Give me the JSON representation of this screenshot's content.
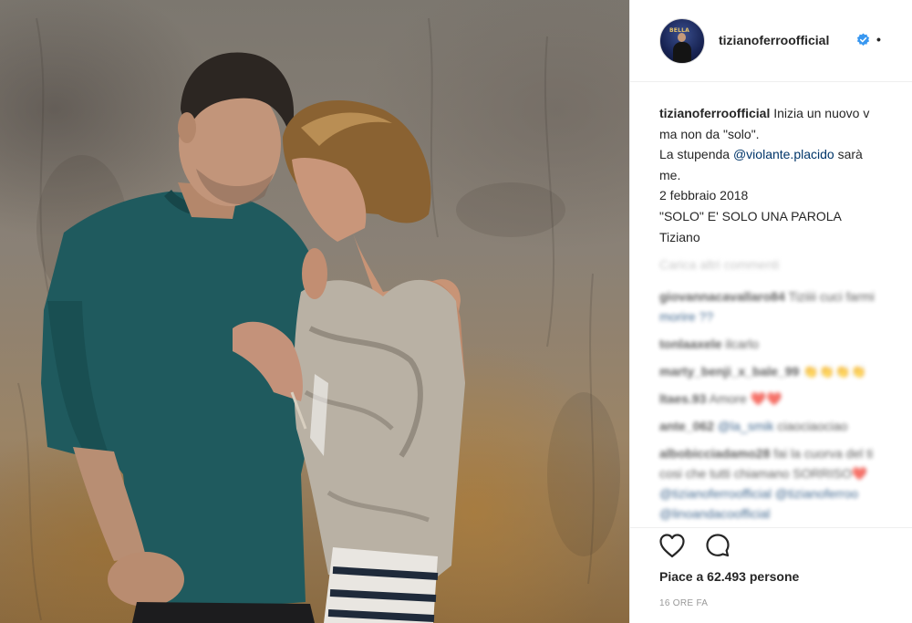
{
  "post": {
    "username": "tizianoferroofficial",
    "separator": "•",
    "avatar_text": "BELLA",
    "caption": {
      "author": "tizianoferroofficial",
      "line1_rest": "Inizia un nuovo v",
      "line2": "ma non da \"solo\".",
      "line3_prefix": "La stupenda ",
      "line3_mention": "@violante.placido",
      "line3_suffix": " sarà",
      "line4": "me.",
      "line5": "2 febbraio 2018",
      "line6": "\"SOLO\" E' SOLO UNA PAROLA",
      "line7": "Tiziano"
    },
    "load_more": "Carica altri commenti",
    "comments": [
      {
        "user": "giovannacavallaro84",
        "text": " Tiziiii cuci farmi",
        "cont": "morire ??"
      },
      {
        "user": "tonlaaxele",
        "text": " ilcarlo",
        "cont": ""
      },
      {
        "user": "marty_benji_x_bale_99",
        "text": " 👏👏👏👏",
        "cont": ""
      },
      {
        "user": "ltaes.93",
        "text": " Amore ❤️❤️",
        "cont": ""
      },
      {
        "user": "ante_062",
        "mention": " @la_smik",
        "text": " ciaociaociao",
        "cont": ""
      },
      {
        "user": "albobicciadamo28",
        "text": " fai la cuorva del ti",
        "cont": "cosi che tutti chiamano SORRISO❤️"
      },
      {
        "mention_line": "@tizianoferroofficial @tizianoferroo",
        "cont2": "@linoandacoofficial"
      }
    ],
    "likes": "Piace a 62.493 persone",
    "time": "16 ORE FA",
    "icons": {
      "like": "heart-icon",
      "comment": "comment-icon",
      "verified": "verified-badge-icon"
    },
    "colors": {
      "mention": "#003569",
      "verified": "#3897f0",
      "muted": "#999999"
    }
  }
}
